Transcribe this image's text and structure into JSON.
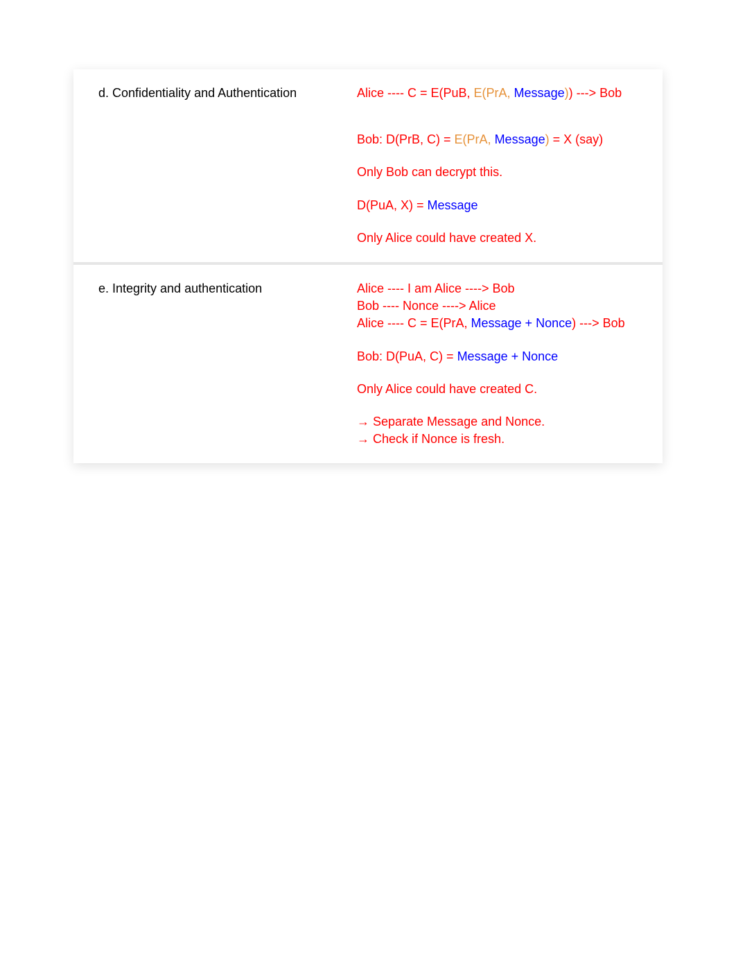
{
  "rows": [
    {
      "marker": "d.",
      "label": "Confidentiality and Authentication",
      "content": {
        "p1": {
          "a": "Alice ---- C = E(PuB, ",
          "b": "E(PrA, ",
          "c": "Message",
          "d": ")",
          "e": ") ---> Bob"
        },
        "p2": {
          "a": "Bob: D(PrB, C) =  ",
          "b": "E(PrA, ",
          "c": "Message",
          "d": ")",
          "e": " = X (say)"
        },
        "p3": "Only Bob can decrypt this.",
        "p4": {
          "a": "D(PuA, X) = ",
          "b": "Message"
        },
        "p5": "Only Alice could have created X."
      }
    },
    {
      "marker": "e.",
      "label": "Integrity and authentication",
      "content": {
        "l1": "Alice ---- I am Alice ----> Bob",
        "l2": "Bob ---- Nonce ----> Alice",
        "l3": {
          "a": "Alice ---- C = E(PrA, ",
          "b": "Message + Nonce",
          "c": ") ---> Bob"
        },
        "l4": {
          "a": "Bob: D(PuA, C) = ",
          "b": "Message + Nonce"
        },
        "l5": "Only Alice could have created C.",
        "l6": "→ Separate Message and Nonce.",
        "l7": "→ Check if Nonce is fresh."
      }
    }
  ]
}
